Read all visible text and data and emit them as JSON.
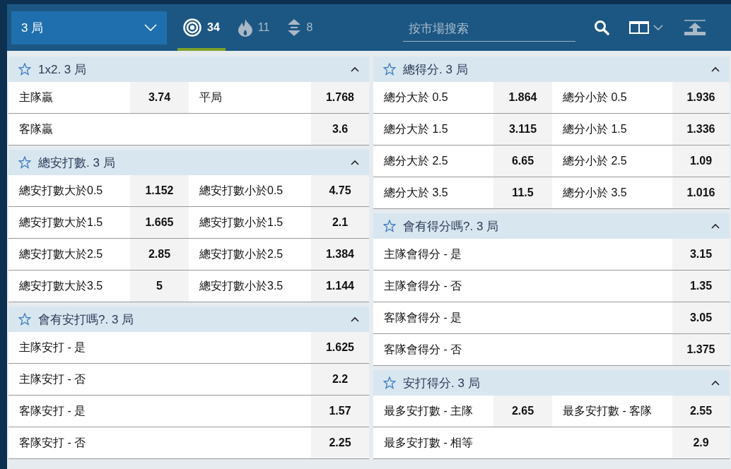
{
  "header": {
    "period_select": {
      "value": "3 局"
    },
    "tabs": [
      {
        "kind": "target",
        "label": "34",
        "selected": true
      },
      {
        "kind": "fire",
        "label": "11",
        "selected": false
      },
      {
        "kind": "updown",
        "label": "8",
        "selected": false
      }
    ],
    "search": {
      "placeholder": "按市場搜索"
    },
    "layout_menu": {
      "expanded": false
    }
  },
  "columns": [
    {
      "markets": [
        {
          "title": "1x2. 3 局",
          "favorite": false,
          "expanded": true,
          "rows": [
            {
              "outcomes": [
                {
                  "label": "主隊贏",
                  "odds": "3.74"
                },
                {
                  "label": "平局",
                  "odds": "1.768"
                }
              ]
            },
            {
              "outcomes": [
                {
                  "label": "客隊贏",
                  "odds": "3.6"
                }
              ]
            }
          ]
        },
        {
          "title": "總安打數. 3 局",
          "favorite": false,
          "expanded": true,
          "rows": [
            {
              "outcomes": [
                {
                  "label": "總安打數大於0.5",
                  "odds": "1.152"
                },
                {
                  "label": "總安打數小於0.5",
                  "odds": "4.75"
                }
              ]
            },
            {
              "outcomes": [
                {
                  "label": "總安打數大於1.5",
                  "odds": "1.665"
                },
                {
                  "label": "總安打數小於1.5",
                  "odds": "2.1"
                }
              ]
            },
            {
              "outcomes": [
                {
                  "label": "總安打數大於2.5",
                  "odds": "2.85"
                },
                {
                  "label": "總安打數小於2.5",
                  "odds": "1.384"
                }
              ]
            },
            {
              "outcomes": [
                {
                  "label": "總安打數大於3.5",
                  "odds": "5"
                },
                {
                  "label": "總安打數小於3.5",
                  "odds": "1.144"
                }
              ]
            }
          ]
        },
        {
          "title": "會有安打嗎?. 3 局",
          "favorite": false,
          "expanded": true,
          "rows": [
            {
              "outcomes": [
                {
                  "label": "主隊安打 - 是",
                  "odds": "1.625"
                }
              ]
            },
            {
              "outcomes": [
                {
                  "label": "主隊安打 - 否",
                  "odds": "2.2"
                }
              ]
            },
            {
              "outcomes": [
                {
                  "label": "客隊安打 - 是",
                  "odds": "1.57"
                }
              ]
            },
            {
              "outcomes": [
                {
                  "label": "客隊安打 - 否",
                  "odds": "2.25"
                }
              ]
            }
          ]
        }
      ]
    },
    {
      "markets": [
        {
          "title": "總得分. 3 局",
          "favorite": false,
          "expanded": true,
          "rows": [
            {
              "outcomes": [
                {
                  "label": "總分大於 0.5",
                  "odds": "1.864"
                },
                {
                  "label": "總分小於 0.5",
                  "odds": "1.936"
                }
              ]
            },
            {
              "outcomes": [
                {
                  "label": "總分大於 1.5",
                  "odds": "3.115"
                },
                {
                  "label": "總分小於 1.5",
                  "odds": "1.336"
                }
              ]
            },
            {
              "outcomes": [
                {
                  "label": "總分大於 2.5",
                  "odds": "6.65"
                },
                {
                  "label": "總分小於 2.5",
                  "odds": "1.09"
                }
              ]
            },
            {
              "outcomes": [
                {
                  "label": "總分大於 3.5",
                  "odds": "11.5"
                },
                {
                  "label": "總分小於 3.5",
                  "odds": "1.016"
                }
              ]
            }
          ]
        },
        {
          "title": "會有得分嗎?. 3 局",
          "favorite": false,
          "expanded": true,
          "rows": [
            {
              "outcomes": [
                {
                  "label": "主隊會得分 - 是",
                  "odds": "3.15"
                }
              ]
            },
            {
              "outcomes": [
                {
                  "label": "主隊會得分 - 否",
                  "odds": "1.35"
                }
              ]
            },
            {
              "outcomes": [
                {
                  "label": "客隊會得分 - 是",
                  "odds": "3.05"
                }
              ]
            },
            {
              "outcomes": [
                {
                  "label": "客隊會得分 - 否",
                  "odds": "1.375"
                }
              ]
            }
          ]
        },
        {
          "title": "安打得分. 3 局",
          "favorite": false,
          "expanded": true,
          "rows": [
            {
              "outcomes": [
                {
                  "label": "最多安打數 - 主隊",
                  "odds": "2.65"
                },
                {
                  "label": "最多安打數 - 客隊",
                  "odds": "2.55"
                }
              ]
            },
            {
              "outcomes": [
                {
                  "label": "最多安打數 - 相等",
                  "odds": "2.9"
                }
              ]
            }
          ]
        }
      ]
    }
  ]
}
